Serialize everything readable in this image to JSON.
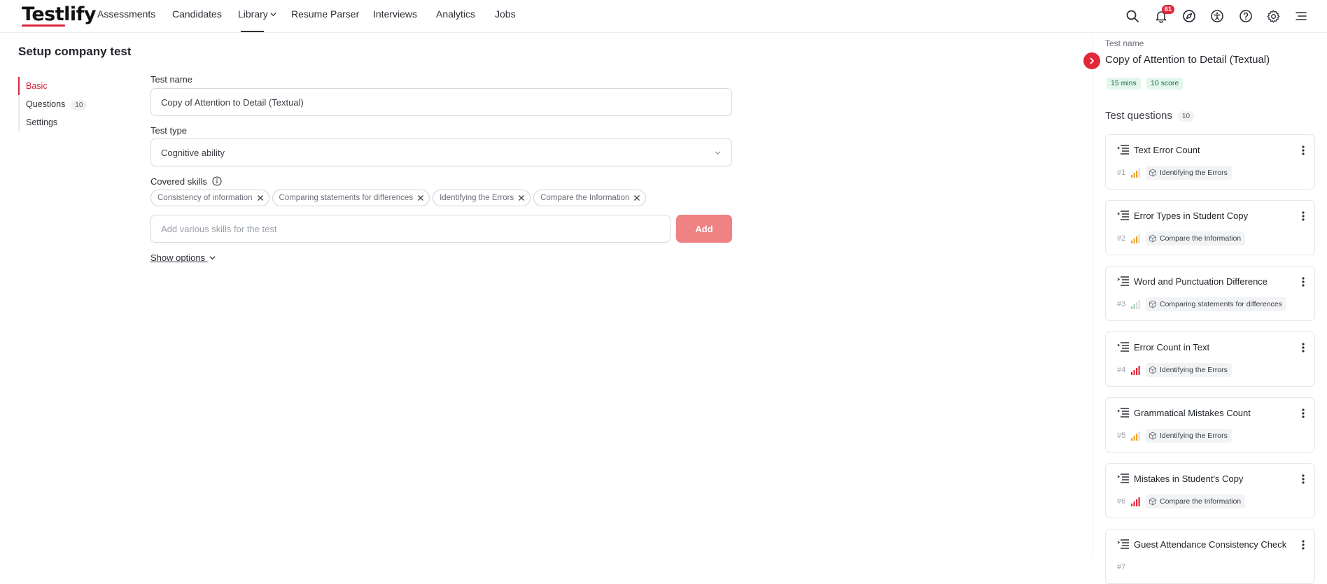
{
  "nav": {
    "logo": "Testlify",
    "links": [
      "Assessments",
      "Candidates",
      "Library",
      "Resume Parser",
      "Interviews",
      "Analytics",
      "Jobs"
    ],
    "notification_count": "61",
    "icons": [
      "search-icon",
      "bell-icon",
      "compass-icon",
      "accessibility-icon",
      "help-icon",
      "gear-icon",
      "menu-icon"
    ]
  },
  "page": {
    "title": "Setup company test"
  },
  "sidebar": {
    "items": [
      {
        "label": "Basic",
        "active": true
      },
      {
        "label": "Questions",
        "count": "10"
      },
      {
        "label": "Settings"
      }
    ]
  },
  "form": {
    "test_name_label": "Test name",
    "test_name_value": "Copy of Attention to Detail (Textual)",
    "test_type_label": "Test type",
    "test_type_value": "Cognitive ability",
    "covered_skills_label": "Covered skills",
    "skills": [
      "Consistency of information",
      "Comparing statements for differences",
      "Identifying the Errors",
      "Compare the Information"
    ],
    "skill_input_placeholder": "Add various skills for the test",
    "add_button": "Add",
    "show_options": "Show options"
  },
  "panel": {
    "label": "Test name",
    "title": "Copy of Attention to Detail (Textual)",
    "duration": "15 mins",
    "score": "10 score",
    "questions_heading": "Test questions",
    "questions_count": "10",
    "questions": [
      {
        "num": "#1",
        "title": "Text Error Count",
        "skill": "Identifying the Errors",
        "difficulty": "medium"
      },
      {
        "num": "#2",
        "title": "Error Types in Student Copy",
        "skill": "Compare the Information",
        "difficulty": "medium"
      },
      {
        "num": "#3",
        "title": "Word and Punctuation Difference",
        "skill": "Comparing statements for differences",
        "difficulty": "easy"
      },
      {
        "num": "#4",
        "title": "Error Count in Text",
        "skill": "Identifying the Errors",
        "difficulty": "hard"
      },
      {
        "num": "#5",
        "title": "Grammatical Mistakes Count",
        "skill": "Identifying the Errors",
        "difficulty": "medium"
      },
      {
        "num": "#6",
        "title": "Mistakes in Student's Copy",
        "skill": "Compare the Information",
        "difficulty": "hard"
      },
      {
        "num": "#7",
        "title": "Guest Attendance Consistency Check",
        "skill": "",
        "difficulty": ""
      }
    ]
  },
  "colors": {
    "brand_red": "#d7263d",
    "add_button": "#ef8282",
    "tag_bg": "#e2f6ec",
    "bar_medium": "#f0a020",
    "bar_hard": "#e0283b",
    "bar_easy": "#9fd3b5"
  }
}
